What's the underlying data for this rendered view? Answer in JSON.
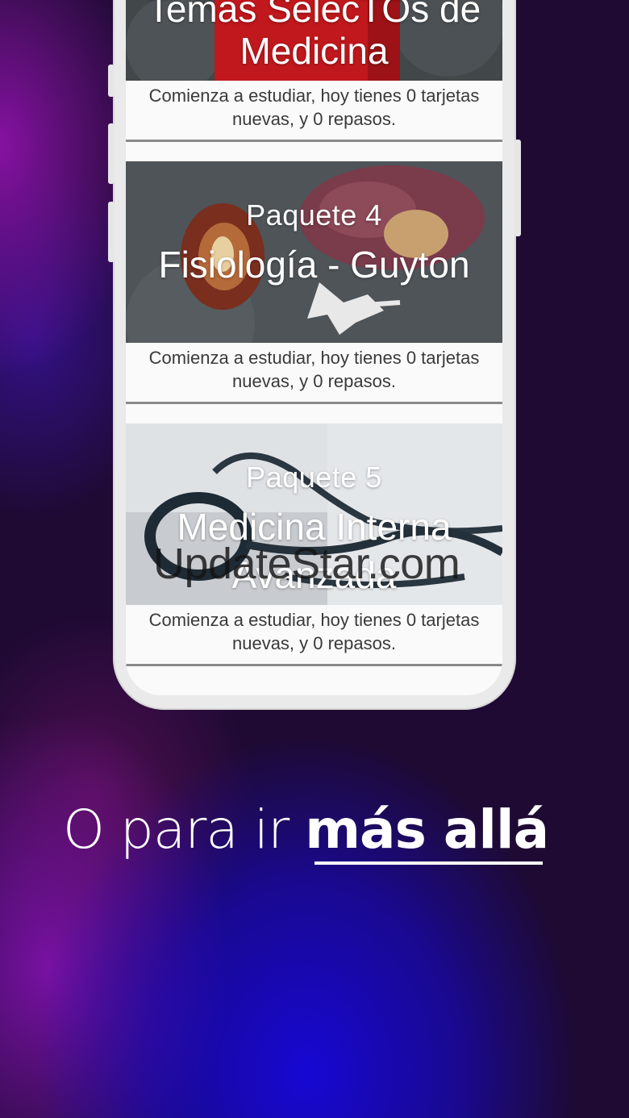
{
  "cards": [
    {
      "package": "",
      "name_line1": "Temas SelecTOs de",
      "name_line2": "Medicina",
      "caption_line1": "Comienza a estudiar, hoy tienes 0 tarjetas",
      "caption_line2": "nuevas, y 0 repasos."
    },
    {
      "package": "Paquete 4",
      "name_line1": "Fisiología - Guyton",
      "name_line2": "",
      "caption_line1": "Comienza a estudiar, hoy tienes 0 tarjetas",
      "caption_line2": "nuevas, y 0 repasos."
    },
    {
      "package": "Paquete 5",
      "name_line1": "Medicina Interna",
      "name_line2": "Avanzada",
      "caption_line1": "Comienza a estudiar, hoy tienes 0 tarjetas",
      "caption_line2": "nuevas, y 0 repasos."
    }
  ],
  "watermark": "UpdateStar.com",
  "tagline": {
    "regular": "O para ir ",
    "bold": "más allá"
  },
  "colors": {
    "background": "#1e0a33",
    "accent_blue": "#1608dc",
    "accent_purple": "#9614c8"
  }
}
